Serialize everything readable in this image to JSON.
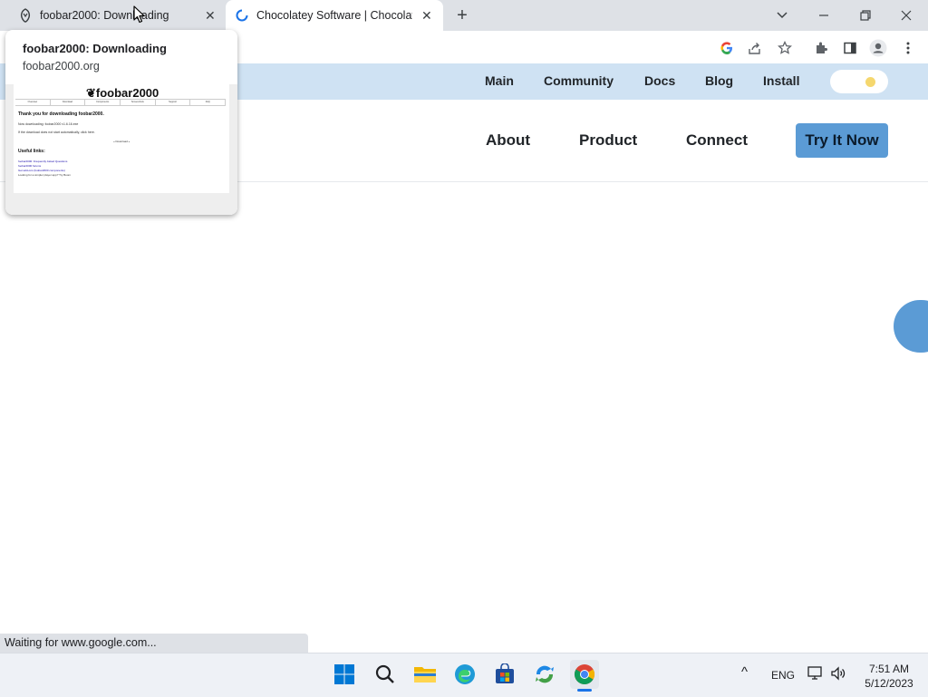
{
  "browser": {
    "tabs": [
      {
        "title": "foobar2000: Downloading",
        "close": "✕"
      },
      {
        "title": "Chocolatey Software | Chocolatey",
        "close": "✕"
      }
    ],
    "new_tab": "+",
    "window": {
      "dropdown": "⌄",
      "minimize": "—",
      "restore": "❐",
      "close": "✕"
    },
    "toolbar_icons": [
      "google-icon",
      "share-icon",
      "star-icon",
      "extensions-icon",
      "side-panel-icon",
      "profile-icon",
      "menu-icon"
    ],
    "status_text": "Waiting for www.google.com..."
  },
  "hover_card": {
    "title": "foobar2000: Downloading",
    "domain": "foobar2000.org",
    "thumbnail": {
      "logo": "❦foobar2000",
      "nav": [
        "Overview",
        "Download",
        "Components",
        "Screenshots",
        "Support",
        "FAQ"
      ],
      "heading": "Thank you for downloading foobar2000.",
      "line1": "Now downloading: foobar2000 v1.6.16.exe",
      "line2": "If the download does not start automatically, click here.",
      "line3": "« Download »",
      "links_heading": "Useful links:",
      "links": [
        "foobar2000: Frequently Asked Questions",
        "foobar2000 forums",
        "Get add-ons (foobar2000 components)",
        "Looking for a simpler player app? Try Boom"
      ]
    }
  },
  "site": {
    "top_nav": [
      "Main",
      "Community",
      "Docs",
      "Blog",
      "Install"
    ],
    "main_nav": [
      "About",
      "Product",
      "Connect"
    ],
    "cta": "Try It Now",
    "colors": {
      "top_nav_bg": "#cfe2f3",
      "accent": "#5b9bd5"
    }
  },
  "taskbar": {
    "apps": [
      "windows-start-icon",
      "search-icon",
      "file-explorer-icon",
      "edge-icon",
      "store-icon",
      "app-icon",
      "chrome-icon"
    ],
    "tray": {
      "chevron": "^",
      "language": "ENG",
      "time": "7:51 AM",
      "date": "5/12/2023"
    }
  }
}
